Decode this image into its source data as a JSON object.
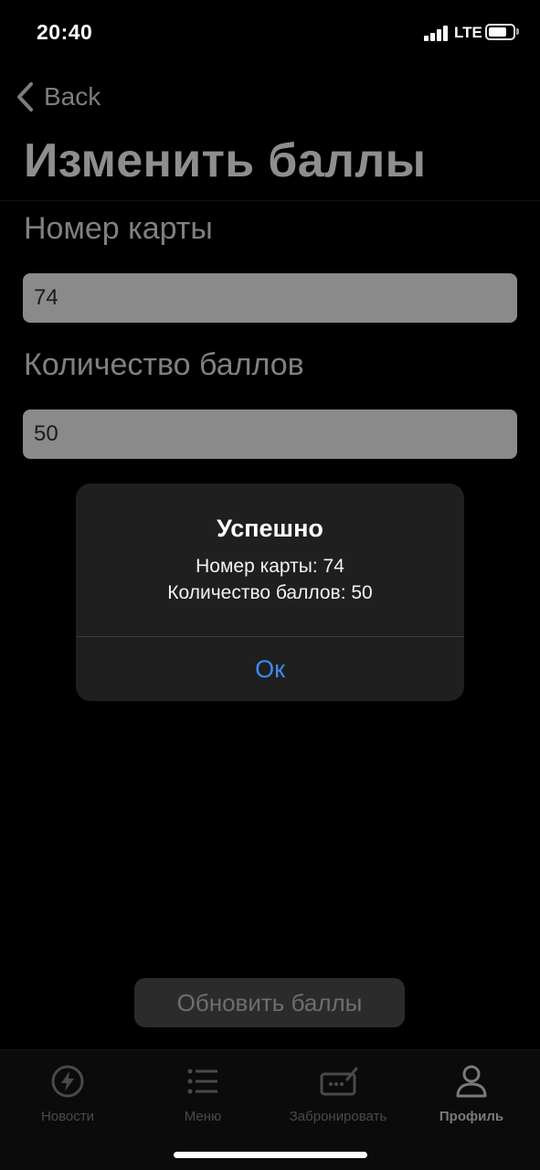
{
  "status_bar": {
    "time": "20:40",
    "network": "LTE"
  },
  "nav": {
    "back_label": "Back",
    "title": "Изменить баллы"
  },
  "form": {
    "card_number_label": "Номер карты",
    "card_number_value": "74",
    "points_label": "Количество баллов",
    "points_value": "50"
  },
  "update_button_label": "Обновить баллы",
  "alert": {
    "title": "Успешно",
    "message_line1": "Номер карты: 74",
    "message_line2": "Количество баллов: 50",
    "ok_label": "Ок"
  },
  "tab_bar": {
    "items": [
      {
        "label": "Новости",
        "icon": "bolt-icon"
      },
      {
        "label": "Меню",
        "icon": "list-icon"
      },
      {
        "label": "Забронировать",
        "icon": "ticket-icon"
      },
      {
        "label": "Профиль",
        "icon": "person-icon"
      }
    ],
    "active_index": 3
  },
  "colors": {
    "background": "#000000",
    "accent": "#3d8bf0",
    "alert_background": "#1f1f1f"
  }
}
